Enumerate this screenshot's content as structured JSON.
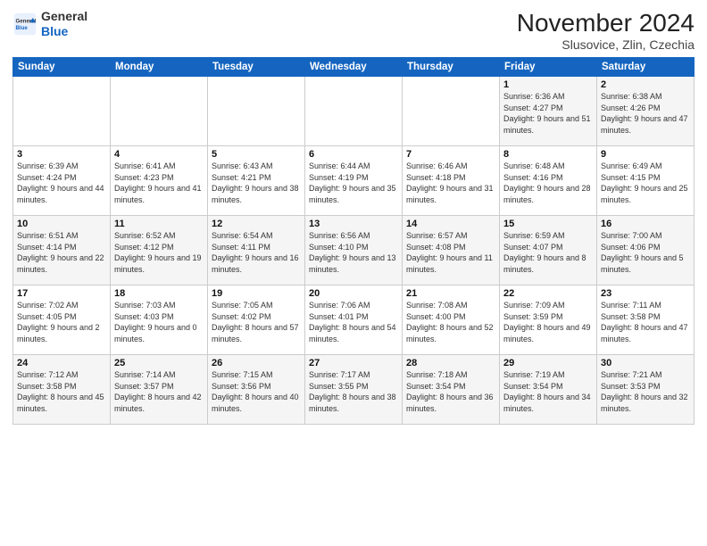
{
  "header": {
    "logo_line1": "General",
    "logo_line2": "Blue",
    "month_title": "November 2024",
    "subtitle": "Slusovice, Zlin, Czechia"
  },
  "days_of_week": [
    "Sunday",
    "Monday",
    "Tuesday",
    "Wednesday",
    "Thursday",
    "Friday",
    "Saturday"
  ],
  "weeks": [
    [
      {
        "day": "",
        "info": ""
      },
      {
        "day": "",
        "info": ""
      },
      {
        "day": "",
        "info": ""
      },
      {
        "day": "",
        "info": ""
      },
      {
        "day": "",
        "info": ""
      },
      {
        "day": "1",
        "info": "Sunrise: 6:36 AM\nSunset: 4:27 PM\nDaylight: 9 hours and 51 minutes."
      },
      {
        "day": "2",
        "info": "Sunrise: 6:38 AM\nSunset: 4:26 PM\nDaylight: 9 hours and 47 minutes."
      }
    ],
    [
      {
        "day": "3",
        "info": "Sunrise: 6:39 AM\nSunset: 4:24 PM\nDaylight: 9 hours and 44 minutes."
      },
      {
        "day": "4",
        "info": "Sunrise: 6:41 AM\nSunset: 4:23 PM\nDaylight: 9 hours and 41 minutes."
      },
      {
        "day": "5",
        "info": "Sunrise: 6:43 AM\nSunset: 4:21 PM\nDaylight: 9 hours and 38 minutes."
      },
      {
        "day": "6",
        "info": "Sunrise: 6:44 AM\nSunset: 4:19 PM\nDaylight: 9 hours and 35 minutes."
      },
      {
        "day": "7",
        "info": "Sunrise: 6:46 AM\nSunset: 4:18 PM\nDaylight: 9 hours and 31 minutes."
      },
      {
        "day": "8",
        "info": "Sunrise: 6:48 AM\nSunset: 4:16 PM\nDaylight: 9 hours and 28 minutes."
      },
      {
        "day": "9",
        "info": "Sunrise: 6:49 AM\nSunset: 4:15 PM\nDaylight: 9 hours and 25 minutes."
      }
    ],
    [
      {
        "day": "10",
        "info": "Sunrise: 6:51 AM\nSunset: 4:14 PM\nDaylight: 9 hours and 22 minutes."
      },
      {
        "day": "11",
        "info": "Sunrise: 6:52 AM\nSunset: 4:12 PM\nDaylight: 9 hours and 19 minutes."
      },
      {
        "day": "12",
        "info": "Sunrise: 6:54 AM\nSunset: 4:11 PM\nDaylight: 9 hours and 16 minutes."
      },
      {
        "day": "13",
        "info": "Sunrise: 6:56 AM\nSunset: 4:10 PM\nDaylight: 9 hours and 13 minutes."
      },
      {
        "day": "14",
        "info": "Sunrise: 6:57 AM\nSunset: 4:08 PM\nDaylight: 9 hours and 11 minutes."
      },
      {
        "day": "15",
        "info": "Sunrise: 6:59 AM\nSunset: 4:07 PM\nDaylight: 9 hours and 8 minutes."
      },
      {
        "day": "16",
        "info": "Sunrise: 7:00 AM\nSunset: 4:06 PM\nDaylight: 9 hours and 5 minutes."
      }
    ],
    [
      {
        "day": "17",
        "info": "Sunrise: 7:02 AM\nSunset: 4:05 PM\nDaylight: 9 hours and 2 minutes."
      },
      {
        "day": "18",
        "info": "Sunrise: 7:03 AM\nSunset: 4:03 PM\nDaylight: 9 hours and 0 minutes."
      },
      {
        "day": "19",
        "info": "Sunrise: 7:05 AM\nSunset: 4:02 PM\nDaylight: 8 hours and 57 minutes."
      },
      {
        "day": "20",
        "info": "Sunrise: 7:06 AM\nSunset: 4:01 PM\nDaylight: 8 hours and 54 minutes."
      },
      {
        "day": "21",
        "info": "Sunrise: 7:08 AM\nSunset: 4:00 PM\nDaylight: 8 hours and 52 minutes."
      },
      {
        "day": "22",
        "info": "Sunrise: 7:09 AM\nSunset: 3:59 PM\nDaylight: 8 hours and 49 minutes."
      },
      {
        "day": "23",
        "info": "Sunrise: 7:11 AM\nSunset: 3:58 PM\nDaylight: 8 hours and 47 minutes."
      }
    ],
    [
      {
        "day": "24",
        "info": "Sunrise: 7:12 AM\nSunset: 3:58 PM\nDaylight: 8 hours and 45 minutes."
      },
      {
        "day": "25",
        "info": "Sunrise: 7:14 AM\nSunset: 3:57 PM\nDaylight: 8 hours and 42 minutes."
      },
      {
        "day": "26",
        "info": "Sunrise: 7:15 AM\nSunset: 3:56 PM\nDaylight: 8 hours and 40 minutes."
      },
      {
        "day": "27",
        "info": "Sunrise: 7:17 AM\nSunset: 3:55 PM\nDaylight: 8 hours and 38 minutes."
      },
      {
        "day": "28",
        "info": "Sunrise: 7:18 AM\nSunset: 3:54 PM\nDaylight: 8 hours and 36 minutes."
      },
      {
        "day": "29",
        "info": "Sunrise: 7:19 AM\nSunset: 3:54 PM\nDaylight: 8 hours and 34 minutes."
      },
      {
        "day": "30",
        "info": "Sunrise: 7:21 AM\nSunset: 3:53 PM\nDaylight: 8 hours and 32 minutes."
      }
    ]
  ]
}
